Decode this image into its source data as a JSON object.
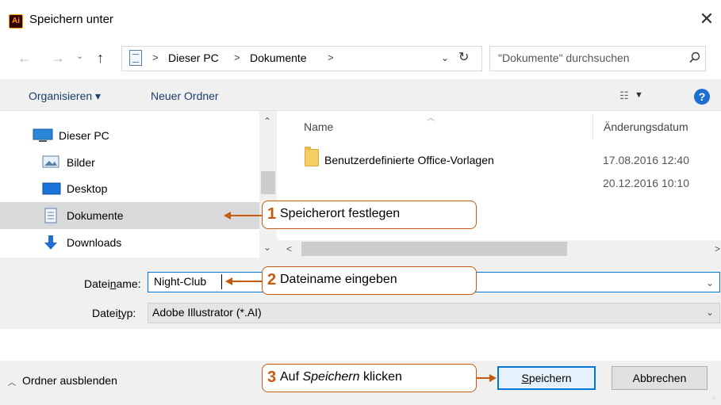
{
  "window": {
    "title": "Speichern unter",
    "app_icon_text": "Ai"
  },
  "address": {
    "crumbs": [
      "Dieser PC",
      "Dokumente"
    ],
    "separator": ">",
    "search_placeholder": "\"Dokumente\" durchsuchen"
  },
  "toolbar": {
    "organize_label": "Organisieren ▾",
    "new_folder_label": "Neuer Ordner"
  },
  "sidebar": {
    "items": [
      {
        "label": "Dieser PC"
      },
      {
        "label": "Bilder"
      },
      {
        "label": "Desktop"
      },
      {
        "label": "Dokumente",
        "selected": true
      },
      {
        "label": "Downloads"
      }
    ]
  },
  "files": {
    "columns": [
      "Name",
      "Änderungsdatum"
    ],
    "rows": [
      {
        "name": "Benutzerdefinierte Office-Vorlagen",
        "date": "17.08.2016 12:40"
      },
      {
        "name": "",
        "date": "20.12.2016 10:10"
      }
    ]
  },
  "form": {
    "filename_label_pre": "Datei",
    "filename_label_u": "n",
    "filename_label_post": "ame:",
    "filename_value": "Night-Club",
    "filetype_label_pre": "Datei",
    "filetype_label_u": "t",
    "filetype_label_post": "yp:",
    "filetype_value": "Adobe Illustrator (*.AI)"
  },
  "bottom": {
    "collapse_label": "Ordner ausblenden",
    "save_label_u": "S",
    "save_label_rest": "peichern",
    "cancel_label": "Abbrechen"
  },
  "callouts": [
    {
      "number": "1",
      "text": "Speicherort festlegen"
    },
    {
      "number": "2",
      "text": "Dateiname eingeben"
    },
    {
      "number": "3",
      "text_pre": "Auf ",
      "text_em": "Speichern",
      "text_post": " klicken"
    }
  ],
  "colors": {
    "accent": "#0078d7",
    "callout": "#c55a11",
    "selection": "#d9d9d9"
  }
}
